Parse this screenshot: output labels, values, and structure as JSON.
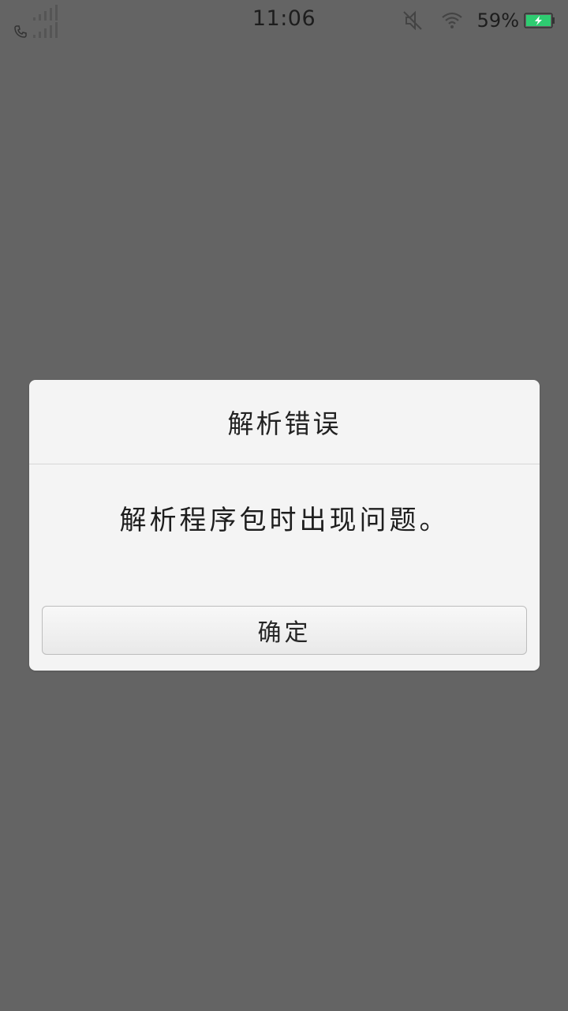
{
  "status_bar": {
    "time": "11:06",
    "battery_percent": "59%",
    "icons": {
      "signal": "signal-bars-icon",
      "call": "phone-icon",
      "mute": "mute-icon",
      "wifi": "wifi-icon",
      "battery": "battery-charging-icon"
    },
    "battery_color": "#2ecc71"
  },
  "dialog": {
    "title": "解析错误",
    "message": "解析程序包时出现问题。",
    "confirm_label": "确定"
  },
  "colors": {
    "overlay": "#646464",
    "dialog_bg": "#f4f4f4"
  }
}
